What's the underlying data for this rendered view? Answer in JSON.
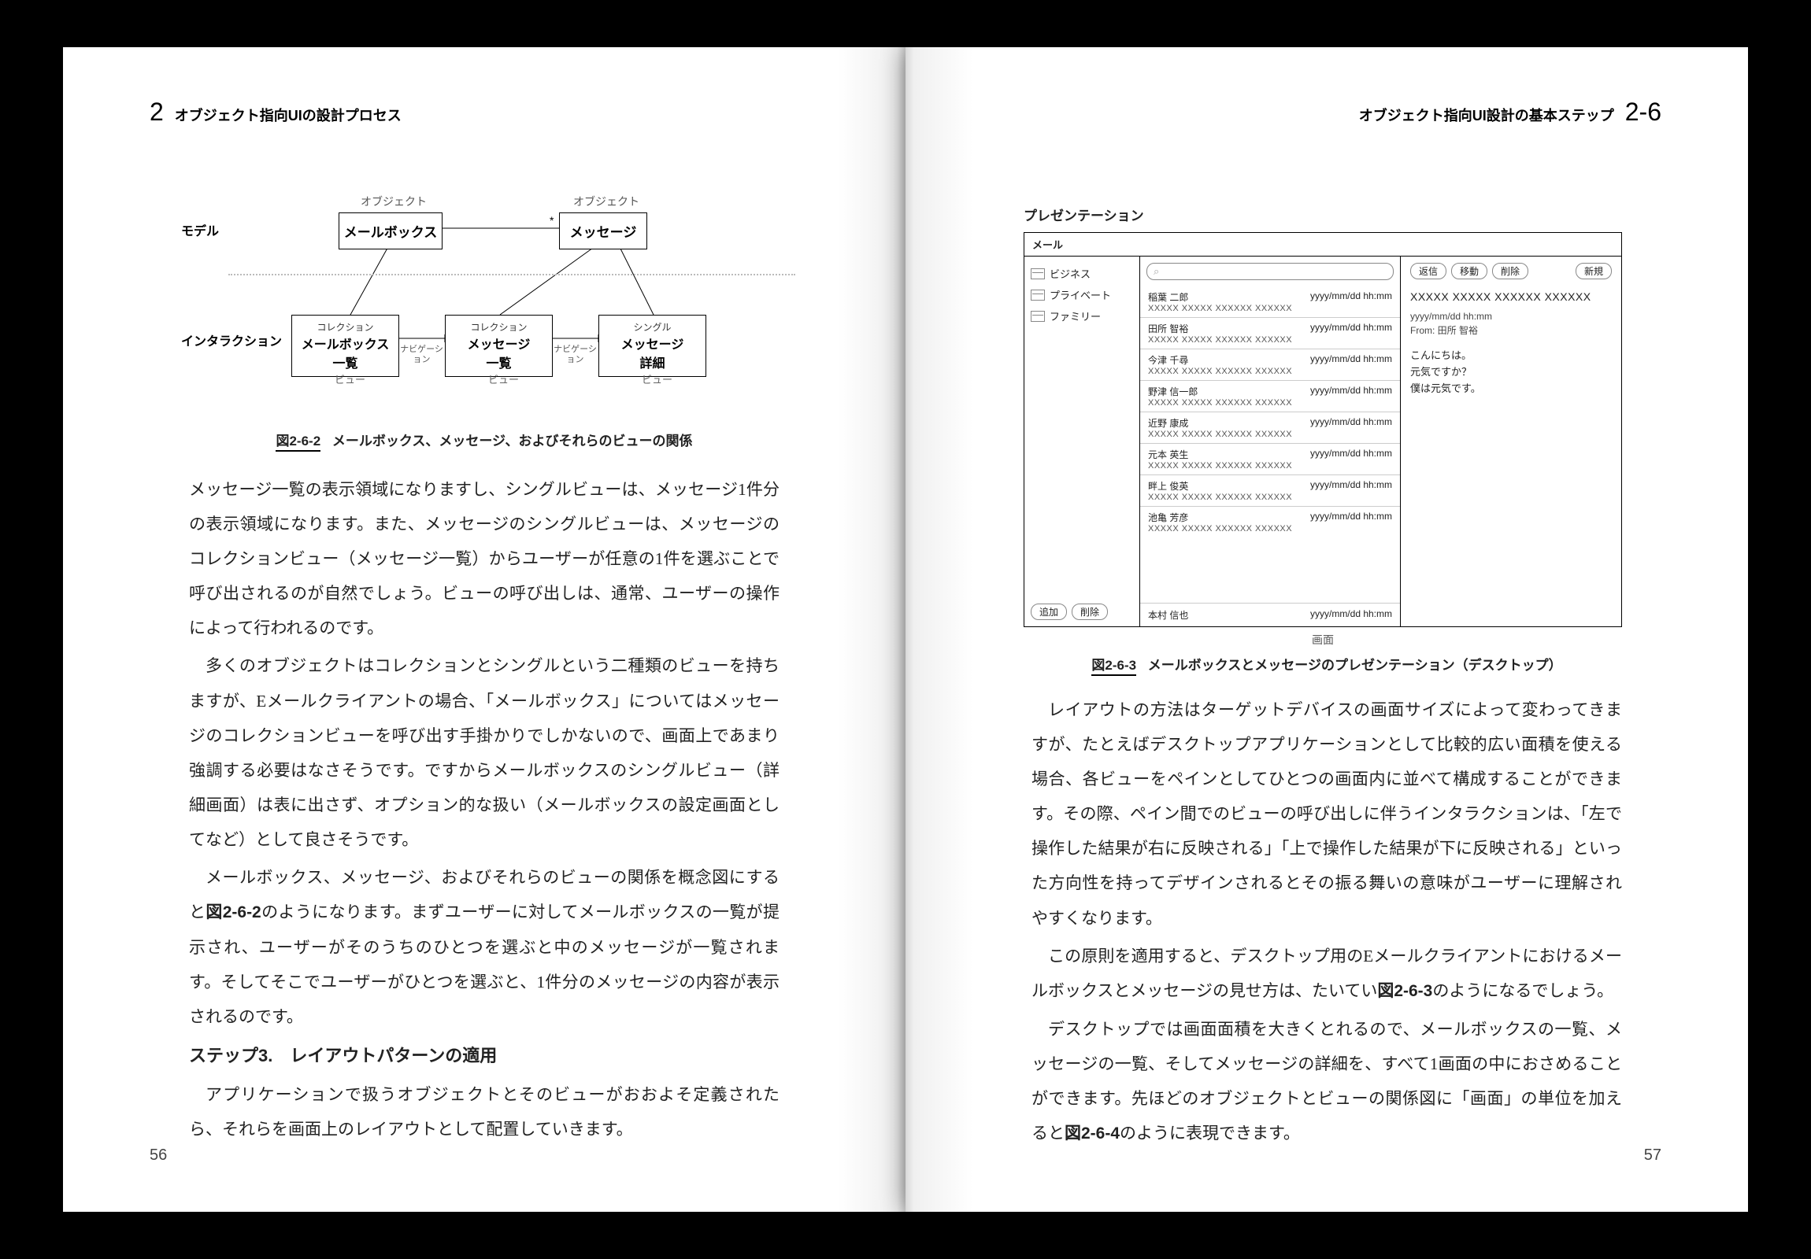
{
  "left": {
    "chapter_num": "2",
    "chapter_title": "オブジェクト指向UIの設計プロセス",
    "folio": "56",
    "figA": {
      "row_model": "モデル",
      "row_interaction": "インタラクション",
      "obj_label": "オブジェクト",
      "box_mailbox": "メールボックス",
      "box_message": "メッセージ",
      "star": "*",
      "collection": "コレクション",
      "single": "シングル",
      "v1_name": "メールボックス",
      "v1_sub": "一覧",
      "v2_name": "メッセージ",
      "v2_sub": "一覧",
      "v3_name": "メッセージ",
      "v3_sub": "詳細",
      "nav": "ナビゲーション",
      "view": "ビュー"
    },
    "caption_num": "図2-6-2",
    "caption_txt": "メールボックス、メッセージ、およびそれらのビューの関係",
    "p1": "メッセージ一覧の表示領域になりますし、シングルビューは、メッセージ1件分の表示領域になります。また、メッセージのシングルビューは、メッセージのコレクションビュー（メッセージ一覧）からユーザーが任意の1件を選ぶことで呼び出されるのが自然でしょう。ビューの呼び出しは、通常、ユーザーの操作によって行われるのです。",
    "p2": "多くのオブジェクトはコレクションとシングルという二種類のビューを持ちますが、Eメールクライアントの場合、「メールボックス」についてはメッセージのコレクションビューを呼び出す手掛かりでしかないので、画面上であまり強調する必要はなさそうです。ですからメールボックスのシングルビュー（詳細画面）は表に出さず、オプション的な扱い（メールボックスの設定画面としてなど）として良さそうです。",
    "p3a": "メールボックス、メッセージ、およびそれらのビューの関係を概念図にすると",
    "p3b": "図2-6-2",
    "p3c": "のようになります。まずユーザーに対してメールボックスの一覧が提示され、ユーザーがそのうちのひとつを選ぶと中のメッセージが一覧されます。そしてそこでユーザーがひとつを選ぶと、1件分のメッセージの内容が表示されるのです。",
    "h3": "ステップ3.　レイアウトパターンの適用",
    "p4": "アプリケーションで扱うオブジェクトとそのビューがおおよそ定義されたら、それらを画面上のレイアウトとして配置していきます。"
  },
  "right": {
    "section_title": "オブジェクト指向UI設計の基本ステップ",
    "section_num": "2-6",
    "folio": "57",
    "figB": {
      "heading": "プレゼンテーション",
      "win_title": "メール",
      "mailboxes": [
        "ビジネス",
        "プライベート",
        "ファミリー"
      ],
      "btn_add": "追加",
      "btn_del": "削除",
      "search_icon": "⌕",
      "date": "yyyy/mm/dd hh:mm",
      "xline": "XXXXX XXXXX XXXXXX XXXXXX",
      "senders": [
        "稲葉 二郎",
        "田所 智裕",
        "今津 千尋",
        "野津 信一郎",
        "近野 康成",
        "元本 英生",
        "畔上 俊英",
        "池亀 芳彦"
      ],
      "more_name": "本村 信也",
      "tb_reply": "返信",
      "tb_move": "移動",
      "tb_del": "削除",
      "tb_new": "新規",
      "subject": "XXXXX XXXXX XXXXXX XXXXXX",
      "meta_date": "yyyy/mm/dd hh:mm",
      "meta_from": "From: 田所 智裕",
      "body1": "こんにちは。",
      "body2": "元気ですか？",
      "body3": "僕は元気です。",
      "screen_label": "画面"
    },
    "caption_num": "図2-6-3",
    "caption_txt": "メールボックスとメッセージのプレゼンテーション（デスクトップ）",
    "p1": "レイアウトの方法はターゲットデバイスの画面サイズによって変わってきますが、たとえばデスクトップアプリケーションとして比較的広い面積を使える場合、各ビューをペインとしてひとつの画面内に並べて構成することができます。その際、ペイン間でのビューの呼び出しに伴うインタラクションは、「左で操作した結果が右に反映される」「上で操作した結果が下に反映される」といった方向性を持ってデザインされるとその振る舞いの意味がユーザーに理解されやすくなります。",
    "p2a": "この原則を適用すると、デスクトップ用のEメールクライアントにおけるメールボックスとメッセージの見せ方は、たいてい",
    "p2b": "図2-6-3",
    "p2c": "のようになるでしょう。",
    "p3a": "デスクトップでは画面面積を大きくとれるので、メールボックスの一覧、メッセージの一覧、そしてメッセージの詳細を、すべて1画面の中におさめることができます。先ほどのオブジェクトとビューの関係図に「画面」の単位を加えると",
    "p3b": "図2-6-4",
    "p3c": "のように表現できます。"
  }
}
